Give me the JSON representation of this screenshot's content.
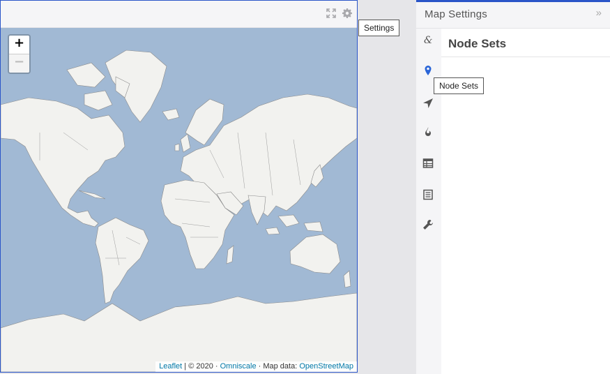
{
  "map_panel": {
    "toolbar": {
      "icons": [
        "expand-icon",
        "gear-icon"
      ]
    },
    "zoom": {
      "in_label": "+",
      "out_label": "−"
    },
    "attribution": {
      "leaflet": "Leaflet",
      "sep1": " | © 2020 · ",
      "omniscale": "Omniscale",
      "sep2": " · Map data: ",
      "osm": "OpenStreetMap"
    },
    "colors": {
      "ocean": "#a1b9d4",
      "land": "#f2f2ef",
      "border": "#6b6b6b",
      "accent": "#2a55c8"
    }
  },
  "tooltips": {
    "settings": "Settings",
    "node_sets": "Node Sets"
  },
  "settings_panel": {
    "title": "Map Settings",
    "collapse_glyph": "»",
    "rail_icons": [
      "ampersand-icon",
      "map-pin-icon",
      "location-arrow-icon",
      "fire-icon",
      "table-icon",
      "list-icon",
      "wrench-icon"
    ],
    "active_icon": "map-pin-icon",
    "content_title": "Node Sets"
  }
}
